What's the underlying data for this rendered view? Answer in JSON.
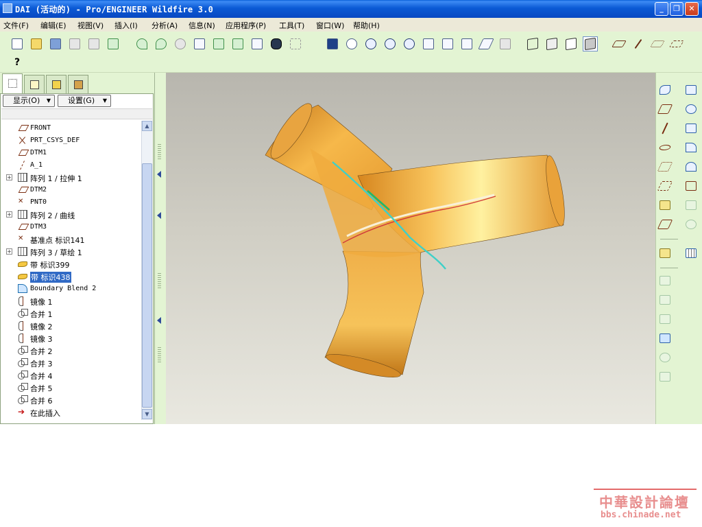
{
  "window": {
    "title": "DAI (活动的) - Pro/ENGINEER Wildfire 3.0",
    "min_glyph": "_",
    "restore_glyph": "❐",
    "close_glyph": "✕"
  },
  "menu": [
    "文件(F)",
    "编辑(E)",
    "视图(V)",
    "插入(I)",
    "分析(A)",
    "信息(N)",
    "应用程序(P)",
    "工具(T)",
    "窗口(W)",
    "帮助(H)"
  ],
  "toolbar": {
    "icons": [
      "new-icon",
      "open-icon",
      "save-icon",
      "print-icon",
      "send-icon",
      "email-icon",
      "undo-icon",
      "redo-icon",
      "cut-icon",
      "copy-icon",
      "paste-icon",
      "paste-special-icon",
      "regenerate-icon",
      "find-icon",
      "select-box-icon",
      "datum-display-icon",
      "spin-center-icon",
      "orient-icon",
      "zoom-in-icon",
      "zoom-out-icon",
      "refit-icon",
      "repaint-icon",
      "saved-views-icon",
      "layers-icon",
      "view-manager-icon",
      "wireframe-icon",
      "hidden-line-icon",
      "no-hidden-icon",
      "shading-icon",
      "datum-planes-toggle-icon",
      "datum-axes-toggle-icon",
      "datum-points-toggle-icon",
      "csys-toggle-icon"
    ],
    "whats_this": "?"
  },
  "navigator": {
    "tabs": [
      "model-tree-tab",
      "folder-browser-tab",
      "favorites-tab",
      "connections-tab"
    ],
    "show_button": "显示(O)",
    "settings_button": "设置(G)",
    "tree": [
      {
        "label": "FRONT",
        "icon": "datum-plane-icon",
        "mono": true,
        "expand": false,
        "selected": false
      },
      {
        "label": "PRT_CSYS_DEF",
        "icon": "csys-icon",
        "mono": true,
        "expand": false,
        "selected": false
      },
      {
        "label": "DTM1",
        "icon": "datum-plane-icon",
        "mono": true,
        "expand": false,
        "selected": false
      },
      {
        "label": "A_1",
        "icon": "datum-axis-icon",
        "mono": true,
        "expand": false,
        "selected": false
      },
      {
        "label": "阵列 1 / 拉伸 1",
        "icon": "pattern-icon",
        "mono": false,
        "expand": true,
        "selected": false
      },
      {
        "label": "DTM2",
        "icon": "datum-plane-icon",
        "mono": true,
        "expand": false,
        "selected": false
      },
      {
        "label": "PNT0",
        "icon": "datum-point-icon",
        "mono": true,
        "expand": false,
        "selected": false
      },
      {
        "label": "阵列 2 / 曲线",
        "icon": "pattern-icon",
        "mono": false,
        "expand": true,
        "selected": false
      },
      {
        "label": "DTM3",
        "icon": "datum-plane-icon",
        "mono": true,
        "expand": false,
        "selected": false
      },
      {
        "label": "基准点 标识141",
        "icon": "datum-point-icon",
        "mono": false,
        "expand": false,
        "selected": false
      },
      {
        "label": "阵列 3 / 草绘 1",
        "icon": "pattern-icon",
        "mono": false,
        "expand": true,
        "selected": false
      },
      {
        "label": "带 标识399",
        "icon": "quilt-icon",
        "mono": false,
        "expand": false,
        "selected": false
      },
      {
        "label": "带 标识438",
        "icon": "quilt-icon",
        "mono": false,
        "expand": false,
        "selected": true
      },
      {
        "label": "Boundary Blend 2",
        "icon": "boundary-blend-icon",
        "mono": true,
        "expand": false,
        "selected": false
      },
      {
        "label": "镜像 1",
        "icon": "mirror-icon",
        "mono": false,
        "expand": false,
        "selected": false
      },
      {
        "label": "合并 1",
        "icon": "merge-icon",
        "mono": false,
        "expand": false,
        "selected": false
      },
      {
        "label": "镜像 2",
        "icon": "mirror-icon",
        "mono": false,
        "expand": false,
        "selected": false
      },
      {
        "label": "镜像 3",
        "icon": "mirror-icon",
        "mono": false,
        "expand": false,
        "selected": false
      },
      {
        "label": "合并 2",
        "icon": "merge-icon",
        "mono": false,
        "expand": false,
        "selected": false
      },
      {
        "label": "合并 3",
        "icon": "merge-icon",
        "mono": false,
        "expand": false,
        "selected": false
      },
      {
        "label": "合并 4",
        "icon": "merge-icon",
        "mono": false,
        "expand": false,
        "selected": false
      },
      {
        "label": "合并 5",
        "icon": "merge-icon",
        "mono": false,
        "expand": false,
        "selected": false
      },
      {
        "label": "合并 6",
        "icon": "merge-icon",
        "mono": false,
        "expand": false,
        "selected": false
      },
      {
        "label": "在此插入",
        "icon": "insert-here-icon",
        "mono": false,
        "expand": false,
        "selected": false
      }
    ]
  },
  "right_toolbar": {
    "icons": [
      "sketched-curve-icon",
      "datum-plane-tool-icon",
      "datum-axis-tool-icon",
      "datum-curve-icon",
      "datum-point-tool-icon",
      "csys-tool-icon",
      "analysis-feature-icon",
      "import-icon",
      "insert-feature-icon",
      "extrude-icon",
      "revolve-icon",
      "sweep-icon",
      "blend-surface-icon",
      "boundary-blend-tool-icon",
      "mirror-tool-icon",
      "merge-tool-icon",
      "trim-tool-icon",
      "pattern-tool-icon",
      "hole-icon",
      "shell-icon",
      "rib-icon",
      "draft-icon",
      "round-icon",
      "chamfer-icon"
    ]
  },
  "watermark": {
    "title": "中華設計論壇",
    "url": "bbs.chinade.net"
  },
  "colors": {
    "model_fill": "#f0a93c",
    "selected_quilt_edge": "#d03a3a",
    "datum_curve": "#3ed0c8",
    "viewport_top": "#b8b6ae",
    "viewport_bottom": "#e9e8e0",
    "selection_highlight": "#316ac5"
  }
}
